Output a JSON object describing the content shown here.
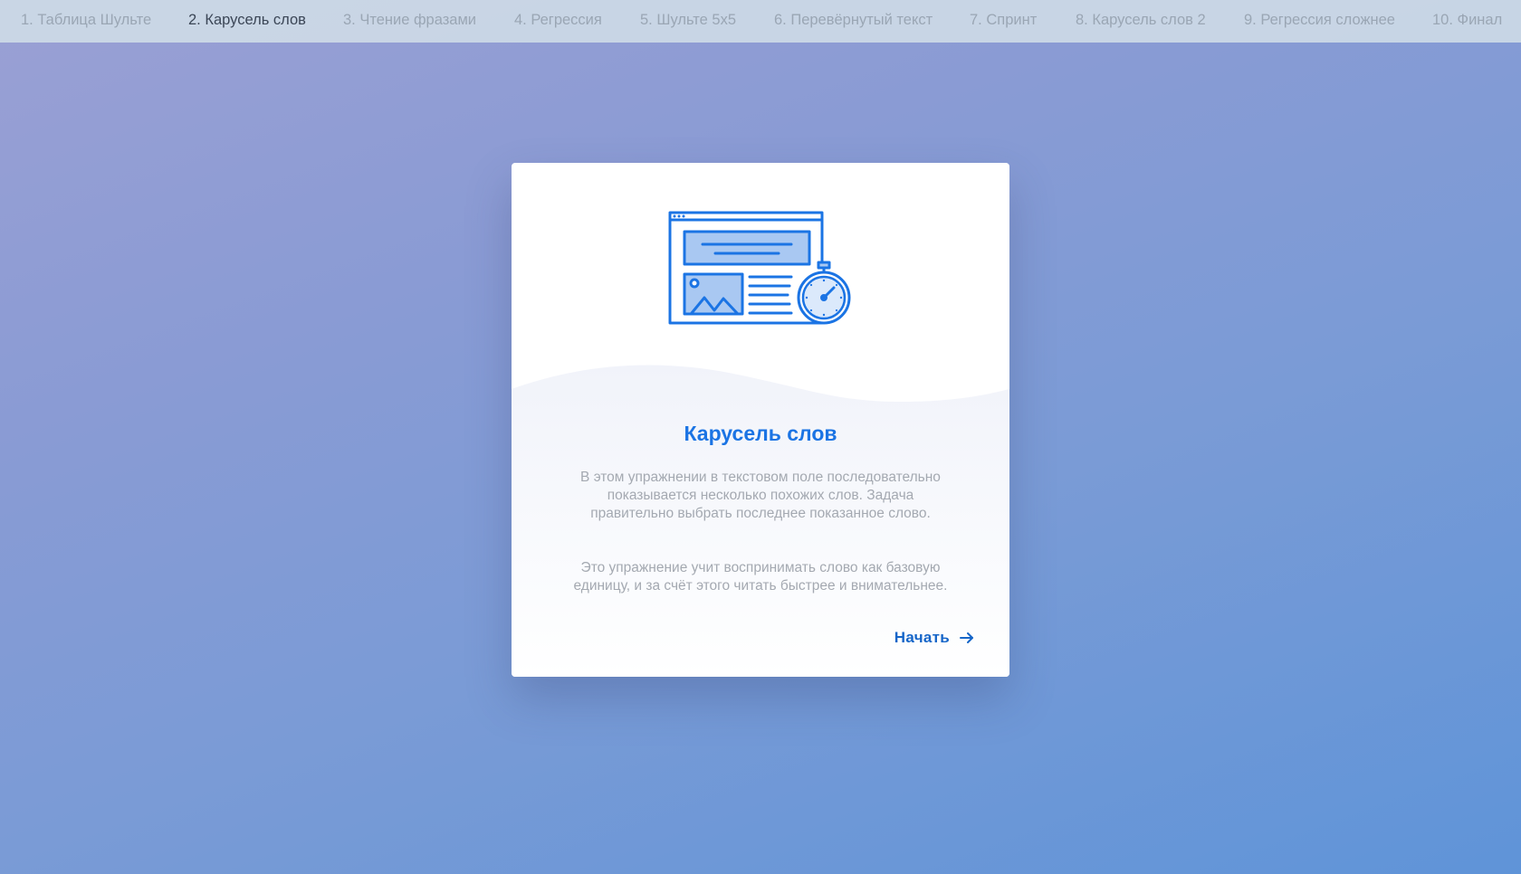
{
  "tabs": [
    {
      "label": "1. Таблица Шульте",
      "active": false
    },
    {
      "label": "2. Карусель слов",
      "active": true
    },
    {
      "label": "3. Чтение фразами",
      "active": false
    },
    {
      "label": "4. Регрессия",
      "active": false
    },
    {
      "label": "5. Шульте 5х5",
      "active": false
    },
    {
      "label": "6. Перевёрнутый текст",
      "active": false
    },
    {
      "label": "7. Спринт",
      "active": false
    },
    {
      "label": "8. Карусель слов 2",
      "active": false
    },
    {
      "label": "9. Регрессия сложнее",
      "active": false
    },
    {
      "label": "10. Финал",
      "active": false
    }
  ],
  "card": {
    "title": "Карусель слов",
    "description_1": "В этом упражнении в текстовом поле последовательно показывается несколько похожих слов. Задача правительно выбрать последнее показанное слово.",
    "description_2": "Это упражнение учит воспринимать слово как базовую единицу, и за счёт этого читать быстрее и внимательнее.",
    "start_label": "Начать",
    "illustration_icon": "browser-stopwatch-icon",
    "arrow_icon": "arrow-right-icon"
  },
  "colors": {
    "accent": "#1b74e4",
    "icon_fill": "#a9c8f2",
    "muted_text": "#a4a9b1",
    "tab_bar": "#cddae6"
  }
}
